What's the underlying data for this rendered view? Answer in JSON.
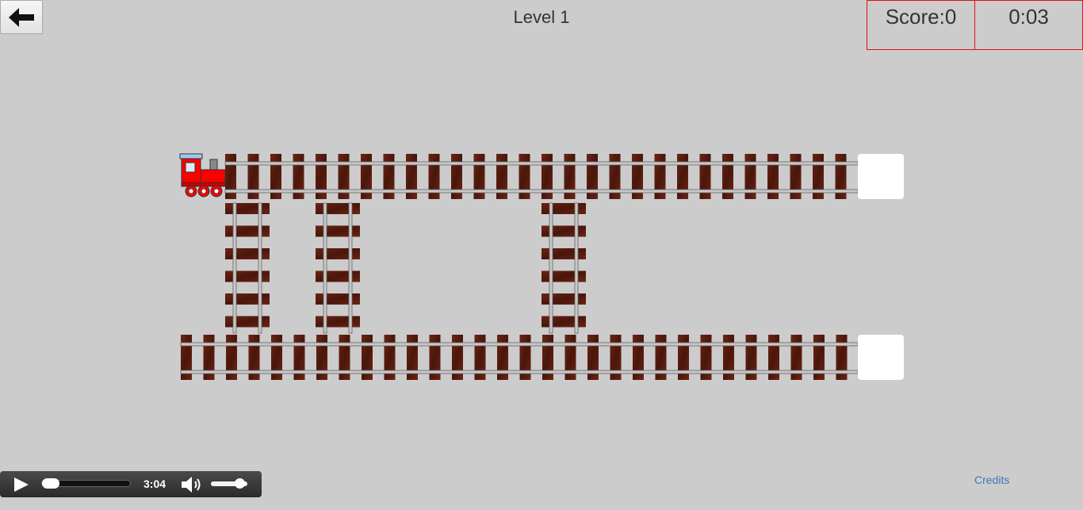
{
  "header": {
    "back_icon": "arrow-left-icon",
    "level_title": "Level 1"
  },
  "hud": {
    "score_text": "Score:0",
    "timer_text": "0:03",
    "border_color": "#e01010"
  },
  "board": {
    "background_color": "#cccccc",
    "tie_color": "#5a1c10",
    "rail_color": "#c8c8c8",
    "goal_color": "#ffffff",
    "train": {
      "icon": "train-engine-icon",
      "body_color": "#ff0000",
      "cab_roof_color": "#9ec7f0"
    },
    "tracks": [
      {
        "name": "top-main-track",
        "orientation": "horizontal"
      },
      {
        "name": "bottom-main-track",
        "orientation": "horizontal"
      },
      {
        "name": "connector-track-1",
        "orientation": "vertical"
      },
      {
        "name": "connector-track-2",
        "orientation": "vertical"
      },
      {
        "name": "connector-track-3",
        "orientation": "vertical"
      }
    ]
  },
  "audio_player": {
    "play_icon": "play-icon",
    "time": "3:04",
    "progress": 0.0,
    "volume_icon": "volume-icon",
    "volume": 0.9
  },
  "footer": {
    "credits_label": "Credits"
  }
}
